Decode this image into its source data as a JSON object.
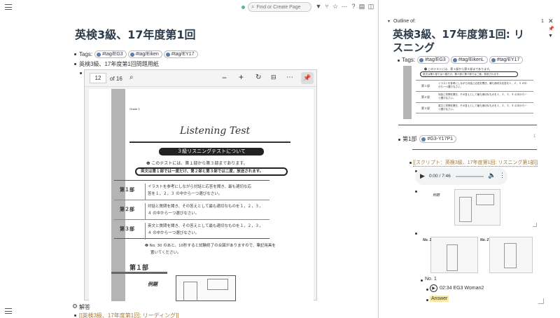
{
  "toolbar": {
    "search_placeholder": "Find or Create Page",
    "icons": [
      "filter-icon",
      "branch-icon",
      "star-icon",
      "more-icon",
      "help-icon",
      "pages-icon",
      "layout-icon"
    ]
  },
  "main": {
    "title": "英検3級、17年度第1回",
    "tags_label": "Tags:",
    "tags": [
      "#tag/EG3",
      "#tag/Eiken",
      "#tag/EY17"
    ],
    "block1_text": "英検3級、17年度第1回問題用紙",
    "answers_label": "解答",
    "link_text": "[[英検3級、17年度第1回: リーディング]]"
  },
  "pdf": {
    "page_number": "12",
    "page_total": "of 16",
    "page": {
      "grade": "Grade 3",
      "heading": "Listening  Test",
      "banner": "３級リスニングテストについて",
      "note1": "❶ このテストには、第１部から第３部まであります。",
      "note_box": "英文は第１部では一度だけ、第２部と第３部では二度、放送されます。",
      "rows": [
        {
          "label": "第１部",
          "text1": "イラストを参考にしながら対話と応答を聞き、最も適切な応",
          "text2": "答を１，２，３ の中から一つ選びなさい。"
        },
        {
          "label": "第２部",
          "text1": "対話と質問を聞き、その答えとして最も適切なものを１，２，３，",
          "text2": "４ の中から一つ選びなさい。"
        },
        {
          "label": "第３部",
          "text1": "英文と質問を聞き、その答えとして最も適切なものを１，２，３，",
          "text2": "４ の中から一つ選びなさい。"
        }
      ],
      "note2a": "❷ No. 30 のあと、10秒すると試験終了の合図がありますので、筆記用具を",
      "note2b": "置いてください。",
      "part1": "第１部",
      "example": "例題"
    }
  },
  "outline": {
    "header": "Outline of:",
    "count": "1",
    "title": "英検3級、17年度第1回: リスニング",
    "tags_label": "Tags:",
    "tags": [
      "#tag/EG3",
      "#tag/EikenL",
      "#tag/EY17"
    ],
    "mini_note1": "❶ このテストには、第１部から第３部まであります。",
    "mini_box": "英文は第１部では一度だけ、第２部と第３部では二度、放送されます。",
    "mini_rows": [
      {
        "label": "第１部",
        "text": "イラストを参考にしながら対話と応答を聞き、最も適切な応答を１，２，３ の中から一つ選びなさい。"
      },
      {
        "label": "第２部",
        "text": "対話と質問を聞き、その答えとして最も適切なものを１，２，３，４ の中から一つ選びなさい。"
      },
      {
        "label": "第３部",
        "text": "英文と質問を聞き、その答えとして最も適切なものを１，２，３，４ の中から一つ選びなさい。"
      }
    ],
    "part1_label": "第1部",
    "part1_tag": "#G3-Y17P1",
    "side_num": "1",
    "script_link": "[[スクリプト：英検3級、17年度第1回: リスニング第1部]]",
    "audio_time": "0:00 / 7:46",
    "example_label": "例題",
    "no1_label": "No. 1",
    "no2_label": "No. 2",
    "no1": "No. 1",
    "audio2": "02:34 EG3 Woman2",
    "answer": "Answer"
  }
}
